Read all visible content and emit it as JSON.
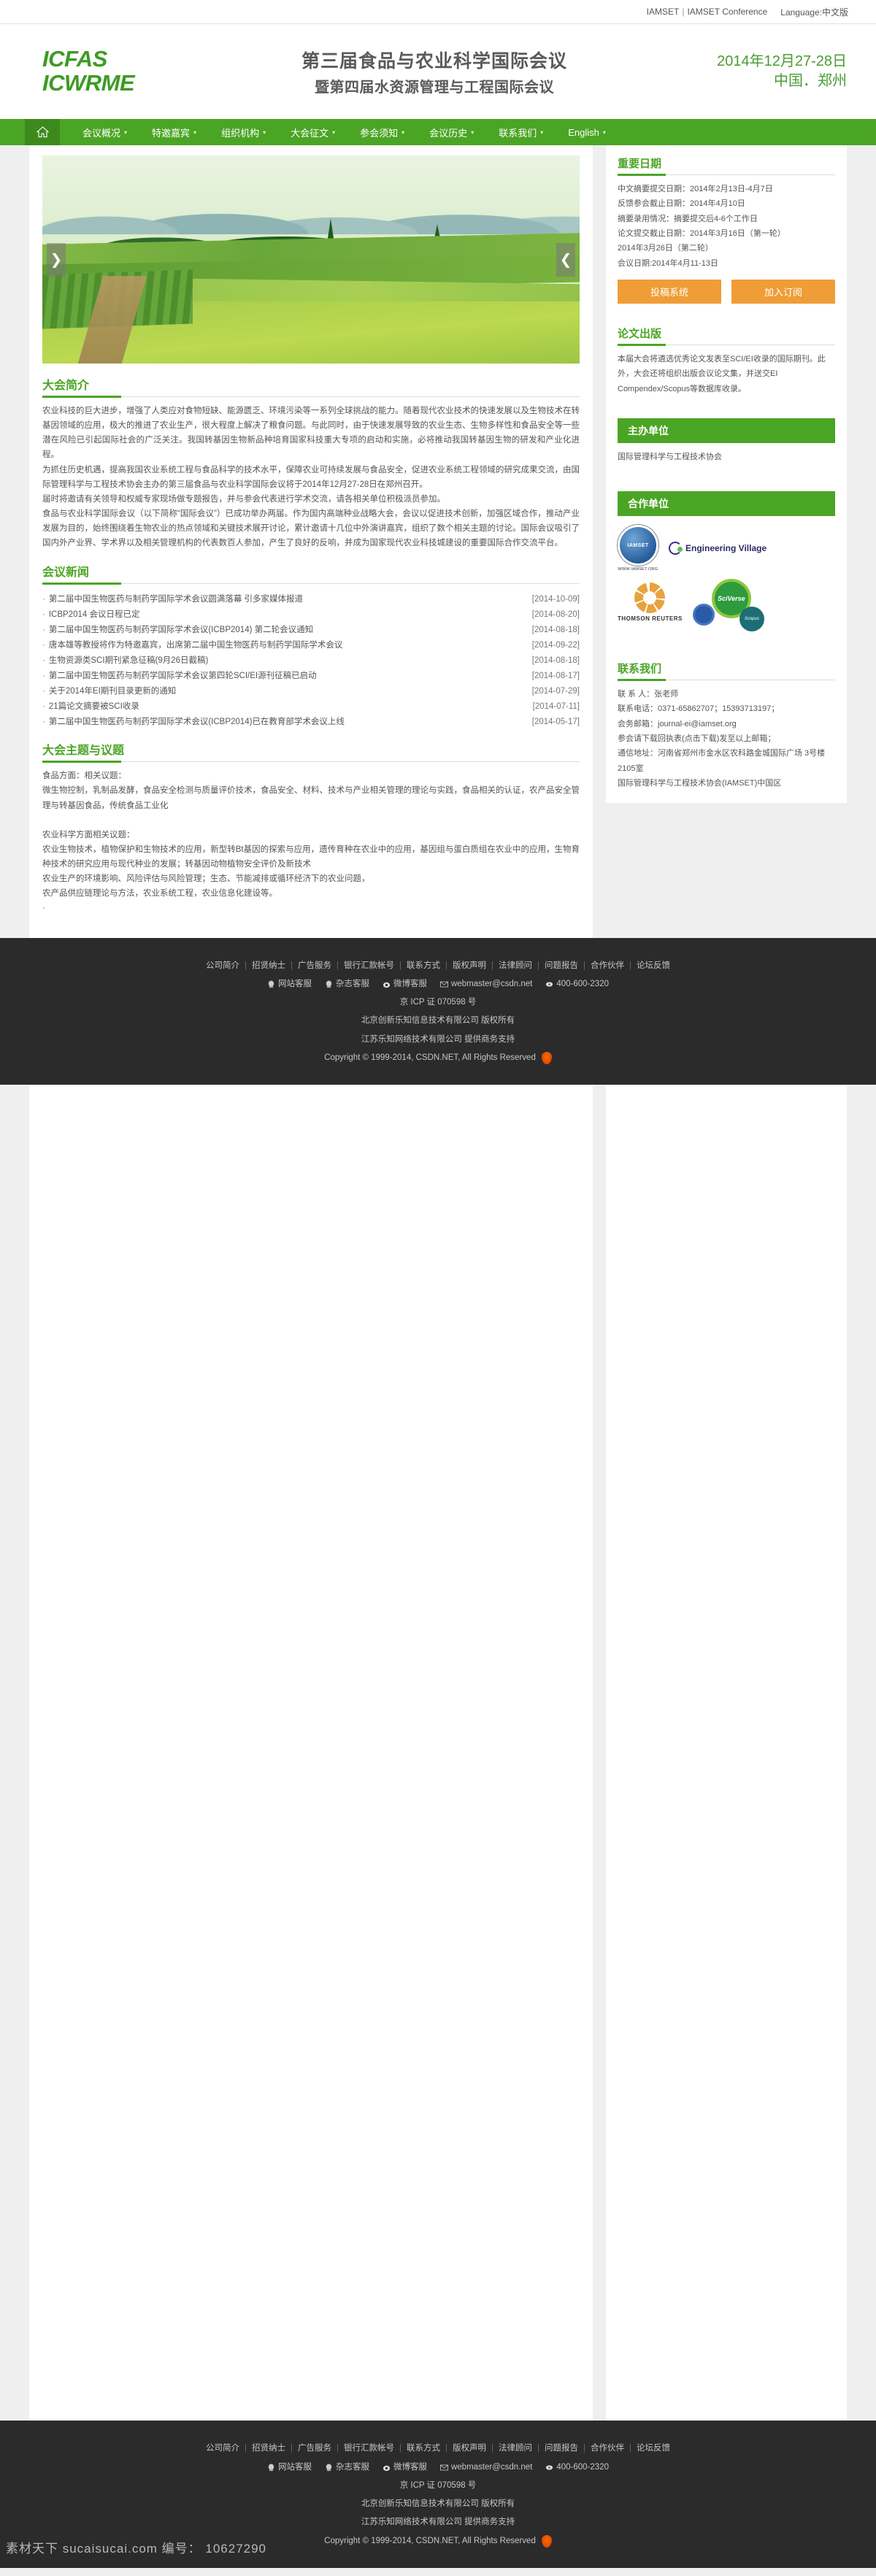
{
  "topbar": {
    "link1": "IAMSET",
    "separator": "|",
    "link2": "IAMSET Conference",
    "language": "Language:中文版"
  },
  "header": {
    "logo_line1": "ICFAS",
    "logo_line2": "ICWRME",
    "title_line1": "第三届食品与农业科学国际会议",
    "title_line2": "暨第四届水资源管理与工程国际会议",
    "date": "2014年12月27-28日",
    "location": "中国．郑州",
    "brand_green": "#4ba524"
  },
  "nav": {
    "home_icon": "home-icon",
    "items": [
      {
        "label": "会议概况",
        "caret": "▾"
      },
      {
        "label": "特邀嘉宾",
        "caret": "▾"
      },
      {
        "label": "组织机构",
        "caret": "▾"
      },
      {
        "label": "大会征文",
        "caret": "▾"
      },
      {
        "label": "参会须知",
        "caret": "▾"
      },
      {
        "label": "会议历史",
        "caret": "▾"
      },
      {
        "label": "联系我们",
        "caret": "▾"
      },
      {
        "label": "English",
        "caret": "▾"
      }
    ]
  },
  "banner": {
    "prev_arrow": "❯",
    "next_arrow": "❮",
    "alt": "绿色农田风景图"
  },
  "intro": {
    "title": "大会简介",
    "paragraphs": [
      "农业科技的巨大进步，增强了人类应对食物短缺、能源匮乏、环境污染等一系列全球挑战的能力。随着现代农业技术的快速发展以及生物技术在转基因领域的应用，极大的推进了农业生产，很大程度上解决了粮食问题。与此同时，由于快速发展导致的农业生态、生物多样性和食品安全等一些潜在风险已引起国际社会的广泛关注。我国转基因生物新品种培育国家科技重大专项的启动和实施，必将推动我国转基因生物的研发和产业化进程。",
      "为抓住历史机遇，提高我国农业系统工程与食品科学的技术水平，保障农业可持续发展与食品安全，促进农业系统工程领域的研究成果交流，由国际管理科学与工程技术协会主办的第三届食品与农业科学国际会议将于2014年12月27-28日在郑州召开。",
      "届时将邀请有关领导和权威专家现场做专题报告，并与参会代表进行学术交流，请各相关单位积极派员参加。",
      "食品与农业科学国际会议（以下简称“国际会议”）已成功举办两届。作为国内高端种业战略大会，会议以促进技术创新，加强区域合作，推动产业发展为目的，始终围绕着生物农业的热点领域和关键技术展开讨论，累计邀请十几位中外演讲嘉宾，组织了数个相关主题的讨论。国际会议吸引了国内外产业界、学术界以及相关管理机构的代表数百人参加，产生了良好的反响，并成为国家现代农业科技城建设的重要国际合作交流平台。"
    ]
  },
  "news": {
    "title": "会议新闻",
    "items": [
      {
        "text": "第二届中国生物医药与制药学国际学术会议圆满落幕 引多家媒体报道",
        "date": "[2014-10-09]"
      },
      {
        "text": "ICBP2014 会议日程已定",
        "date": "[2014-08-20]"
      },
      {
        "text": "第二届中国生物医药与制药学国际学术会议(ICBP2014) 第二轮会议通知",
        "date": "[2014-08-18]"
      },
      {
        "text": "唐本雄等教授将作为特邀嘉宾，出席第二届中国生物医药与制药学国际学术会议",
        "date": "[2014-09-22]"
      },
      {
        "text": "生物资源类SCI期刊紧急征稿(9月26日截稿)",
        "date": "[2014-08-18]"
      },
      {
        "text": "第二届中国生物医药与制药学国际学术会议第四轮SCI/EI源刊征稿已启动",
        "date": "[2014-08-17]"
      },
      {
        "text": "关于2014年EI期刊目录更新的通知",
        "date": "[2014-07-29]"
      },
      {
        "text": "21篇论文摘要被SCI收录",
        "date": "[2014-07-11]"
      },
      {
        "text": "第二届中国生物医药与制药学国际学术会议(ICBP2014)已在教育部学术会议上线",
        "date": "[2014-05-17]"
      }
    ]
  },
  "topics": {
    "title": "大会主题与议题",
    "lines": [
      "食品方面：相关议题：",
      "微生物控制，乳制品发酵，食品安全检测与质量评价技术，食品安全、材料、技术与产业相关管理的理论与实践，食品相关的认证，农产品安全管理与转基因食品，传统食品工业化",
      "",
      "农业科学方面相关议题：",
      "农业生物技术，植物保护和生物技术的应用，新型转Bt基因的探索与应用，遗传育种在农业中的应用，基因组与蛋白质组在农业中的应用，生物育种技术的研究应用与现代种业的发展；转基因动物植物安全评价及新技术",
      "农业生产的环境影响、风险评估与风险管理；生态、节能减排或循环经济下的农业问题，",
      "农产品供应链理论与方法，农业系统工程，农业信息化建设等。",
      "·"
    ]
  },
  "sidebar": {
    "dates": {
      "title": "重要日期",
      "lines": [
        "中文摘要提交日期：2014年2月13日-4月7日",
        "反馈参会截止日期：2014年4月10日",
        "摘要录用情况：摘要提交后4-6个工作日",
        "论文提交截止日期：2014年3月16日（第一轮）",
        "2014年3月26日（第二轮）",
        "会议日期:2014年4月11-13日"
      ],
      "button_submit": "投稿系统",
      "button_subscribe": "加入订阅",
      "button_color": "#ef9d36"
    },
    "publication": {
      "title": "论文出版",
      "text": "本届大会将遴选优秀论文发表至SCI/EI收录的国际期刊。此外，大会还将组织出版会议论文集，并送交EI Compendex/Scopus等数据库收录。"
    },
    "organizer": {
      "bar_label": "主办单位",
      "name": "国际管理科学与工程技术协会"
    },
    "partners": {
      "bar_label": "合作单位",
      "logos": [
        {
          "name": "iamset-logo",
          "text": "IAMSET",
          "url": "WWW.IAMSET.ORG"
        },
        {
          "name": "engineering-village-logo",
          "text": "Engineering Village"
        },
        {
          "name": "thomson-reuters-logo",
          "text": "THOMSON REUTERS"
        },
        {
          "name": "sciverse-scopus-logo",
          "text": "SciVerse",
          "sub": "Scopus"
        }
      ]
    },
    "contact": {
      "title": "联系我们",
      "lines": [
        "联 系 人：张老师",
        "联系电话：0371-65862707；15393713197；",
        "会务邮箱：journal-ei@iamset.org",
        "参会请下载回执表(点击下载)发至以上邮箱；",
        "通信地址：河南省郑州市金水区农科路金城国际广场 3号楼2105室",
        "国际管理科学与工程技术协会(IAMSET)中国区"
      ]
    }
  },
  "footer": {
    "links": [
      "公司简介",
      "招贤纳士",
      "广告服务",
      "银行汇款帐号",
      "联系方式",
      "版权声明",
      "法律顾问",
      "问题报告",
      "合作伙伴",
      "论坛反馈"
    ],
    "separator": "|",
    "services": [
      {
        "icon": "qq-icon",
        "label": "网站客服"
      },
      {
        "icon": "qq-icon",
        "label": "杂志客服"
      },
      {
        "icon": "weibo-icon",
        "label": "微博客服"
      },
      {
        "icon": "mail-icon",
        "label": "webmaster@csdn.net"
      },
      {
        "icon": "phone-icon",
        "label": "400-600-2320"
      }
    ],
    "icp": "京 ICP 证 070598 号",
    "company1": "北京创新乐知信息技术有限公司 版权所有",
    "company2": "江苏乐知网络技术有限公司 提供商务支持",
    "copyright": "Copyright © 1999-2014, CSDN.NET, All Rights Reserved",
    "seal_icon": "police-seal-icon"
  },
  "watermark": {
    "text": "素材天下 sucaisucai.com  编号： 10627290"
  }
}
